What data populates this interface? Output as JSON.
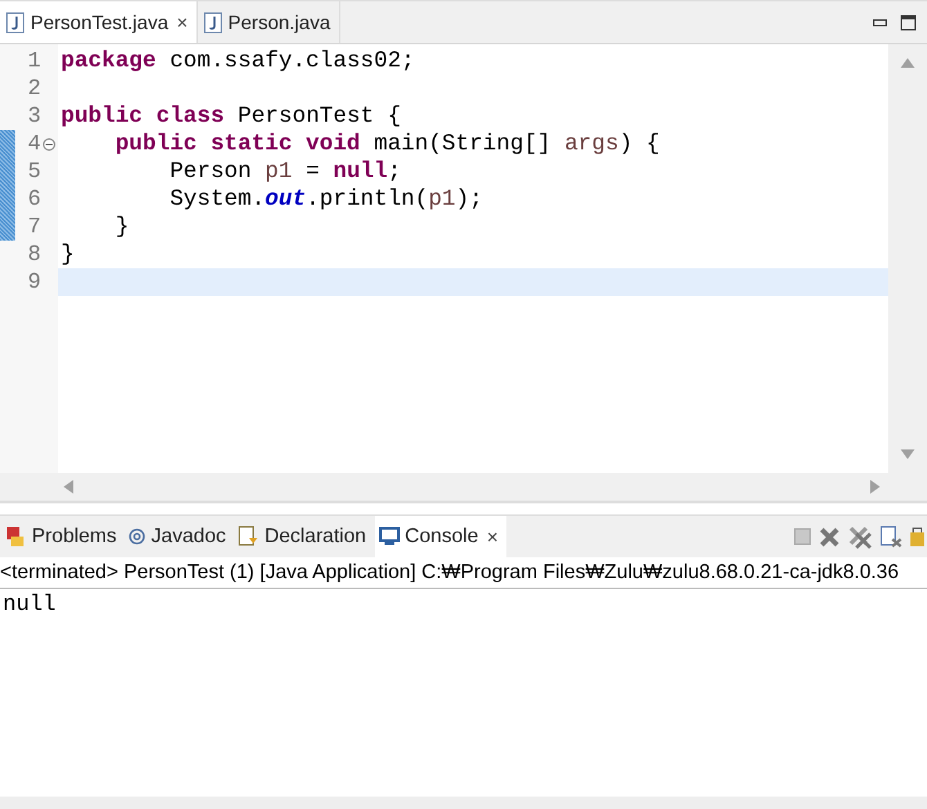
{
  "editor_tabs": [
    {
      "label": "PersonTest.java",
      "selected": true,
      "close": "×"
    },
    {
      "label": "Person.java",
      "selected": false
    }
  ],
  "code": {
    "lines": [
      {
        "number": "1",
        "changed": false,
        "current": false,
        "fold_marker": false,
        "tokens": [
          {
            "text": "package",
            "kind": "keyword"
          },
          {
            "text": " com.ssafy.class02;",
            "kind": "plain"
          }
        ]
      },
      {
        "number": "2",
        "changed": false,
        "current": false,
        "fold_marker": false
      },
      {
        "number": "3",
        "changed": false,
        "current": false,
        "fold_marker": false,
        "tokens": [
          {
            "text": "public class",
            "kind": "keyword"
          },
          {
            "text": " PersonTest {",
            "kind": "plain"
          }
        ]
      },
      {
        "number": "4",
        "changed": true,
        "current": false,
        "fold_marker": true,
        "tokens": [
          {
            "text": "    public static void",
            "kind": "keyword"
          },
          {
            "text": " main(String[] ",
            "kind": "plain"
          },
          {
            "text": "args",
            "kind": "variable"
          },
          {
            "text": ") {",
            "kind": "plain"
          }
        ]
      },
      {
        "number": "5",
        "changed": true,
        "current": false,
        "fold_marker": false,
        "tokens": [
          {
            "text": "        Person ",
            "kind": "plain"
          },
          {
            "text": "p1",
            "kind": "variable"
          },
          {
            "text": " = ",
            "kind": "plain"
          },
          {
            "text": "null",
            "kind": "keyword"
          },
          {
            "text": ";",
            "kind": "plain"
          }
        ]
      },
      {
        "number": "6",
        "changed": true,
        "current": false,
        "fold_marker": false,
        "tokens": [
          {
            "text": "        System.",
            "kind": "plain"
          },
          {
            "text": "out",
            "kind": "field"
          },
          {
            "text": ".println(",
            "kind": "plain"
          },
          {
            "text": "p1",
            "kind": "variable"
          },
          {
            "text": ");",
            "kind": "plain"
          }
        ]
      },
      {
        "number": "7",
        "changed": true,
        "current": false,
        "fold_marker": false,
        "tokens": [
          {
            "text": "    }",
            "kind": "plain"
          }
        ]
      },
      {
        "number": "8",
        "changed": false,
        "current": false,
        "fold_marker": false,
        "tokens": [
          {
            "text": "}",
            "kind": "plain"
          }
        ]
      },
      {
        "number": "9",
        "changed": false,
        "current": true,
        "fold_marker": false
      }
    ]
  },
  "panel_tabs": [
    {
      "label": "Problems",
      "kind": "problems",
      "selected": false
    },
    {
      "label": "Javadoc",
      "kind": "javadoc",
      "selected": false
    },
    {
      "label": "Declaration",
      "kind": "declaration",
      "selected": false
    },
    {
      "label": "Console",
      "kind": "console",
      "selected": true,
      "close": "×"
    }
  ],
  "console": {
    "header": "<terminated> PersonTest (1) [Java Application] C:₩Program Files₩Zulu₩zulu8.68.0.21-ca-jdk8.0.36",
    "output": "null"
  }
}
